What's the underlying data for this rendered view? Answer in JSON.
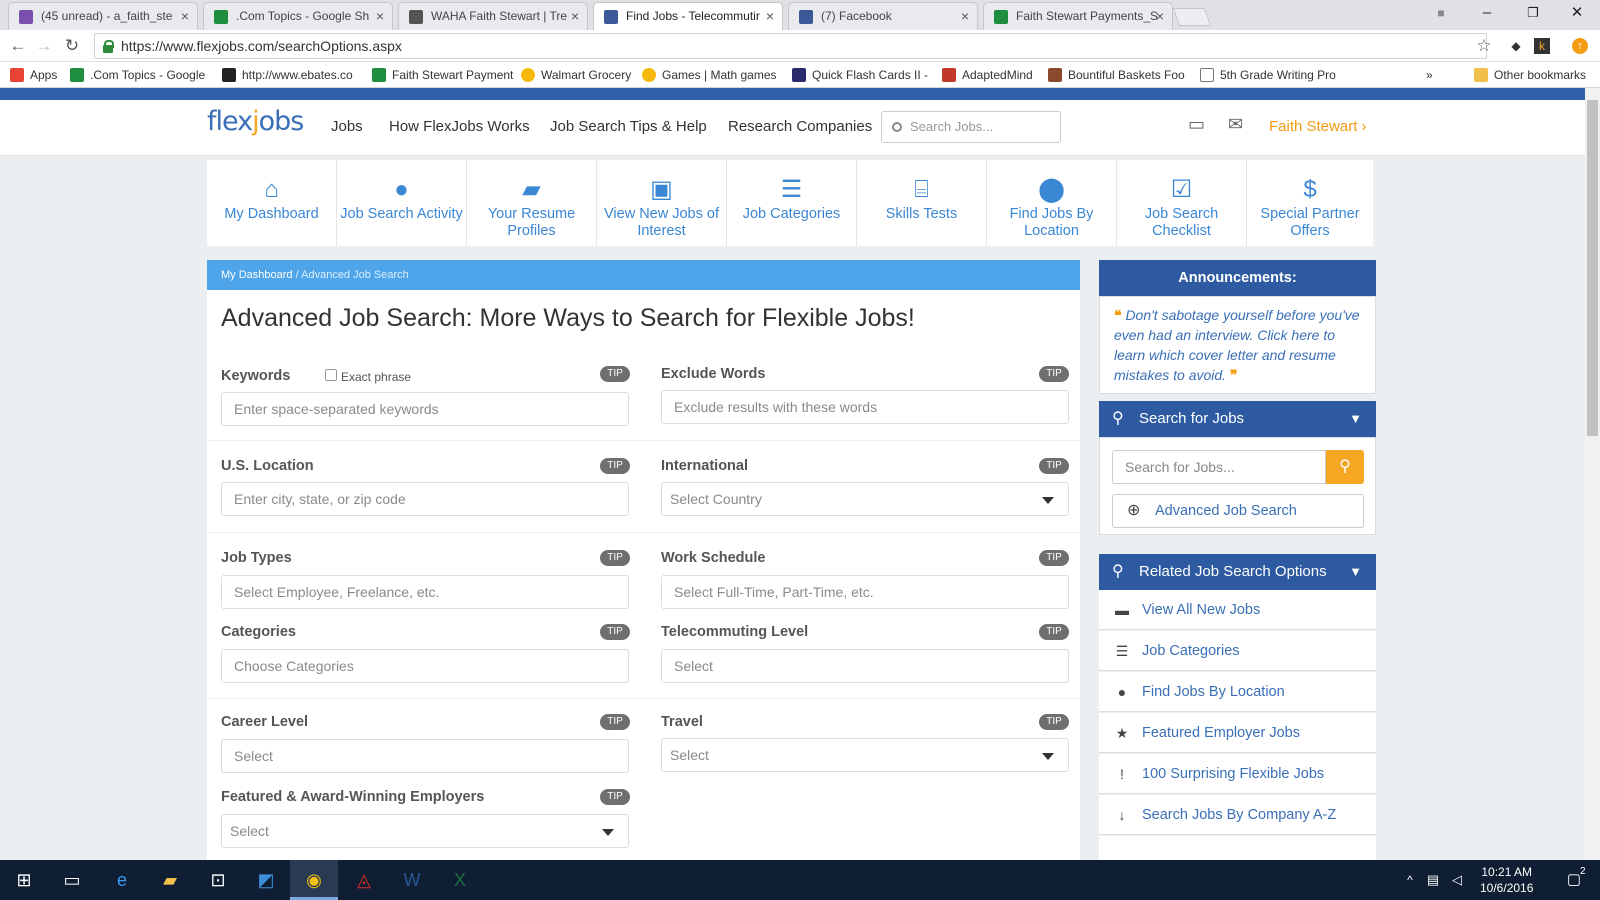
{
  "browser": {
    "tabs": [
      {
        "label": "(45 unread) - a_faith_ste",
        "icon": "mail-icon",
        "color": "#7b4fb0"
      },
      {
        "label": ".Com Topics - Google Sh",
        "icon": "sheets-icon",
        "color": "#1e8e3e"
      },
      {
        "label": "WAHA Faith Stewart | Tre",
        "icon": "trello-icon",
        "color": "#555555"
      },
      {
        "label": "Find Jobs - Telecommutir",
        "icon": "facebook-icon",
        "color": "#3b5998"
      },
      {
        "label": "(7) Facebook",
        "icon": "facebook-icon",
        "color": "#3b5998"
      },
      {
        "label": "Faith Stewart Payments_S",
        "icon": "sheets-icon",
        "color": "#1e8e3e"
      }
    ],
    "url": "https://www.flexjobs.com/searchOptions.aspx",
    "bookmarks": [
      {
        "label": "Apps",
        "color": "#e94335"
      },
      {
        "label": ".Com Topics - Google",
        "color": "#1e8e3e"
      },
      {
        "label": "http://www.ebates.co",
        "color": "#222222"
      },
      {
        "label": "Faith Stewart Payment",
        "color": "#1e8e3e"
      },
      {
        "label": "Walmart Grocery",
        "color": "#f6b80b"
      },
      {
        "label": "Games | Math games",
        "color": "#f6b80b"
      },
      {
        "label": "Quick Flash Cards II -",
        "color": "#2b2b6b"
      },
      {
        "label": "AdaptedMind",
        "color": "#c0392b"
      },
      {
        "label": "Bountiful Baskets Foo",
        "color": "#8b4a2b"
      },
      {
        "label": "5th Grade Writing Pro",
        "color": "#777777"
      }
    ],
    "more_bookmarks": "»",
    "other_bookmarks": "Other bookmarks"
  },
  "site": {
    "logo": {
      "pre": "flex",
      "o": "j",
      "post": "obs"
    },
    "nav": [
      "Jobs",
      "How FlexJobs Works",
      "Job Search Tips & Help",
      "Research Companies"
    ],
    "search_placeholder": "Search Jobs...",
    "user": "Faith Stewart",
    "user_chevron": "›"
  },
  "tiles": [
    {
      "label": "My Dashboard",
      "icon": "home-icon",
      "glyph": "⌂"
    },
    {
      "label": "Job Search Activity",
      "icon": "user-icon",
      "glyph": "●"
    },
    {
      "label": "Your Resume Profiles",
      "icon": "folder-open-icon",
      "glyph": "▰"
    },
    {
      "label": "View New Jobs of Interest",
      "icon": "briefcase-icon",
      "glyph": "▣"
    },
    {
      "label": "Job Categories",
      "icon": "list-icon",
      "glyph": "☰"
    },
    {
      "label": "Skills Tests",
      "icon": "bank-icon",
      "glyph": "⌸"
    },
    {
      "label": "Find Jobs By Location",
      "icon": "map-marker-icon",
      "glyph": "⬤"
    },
    {
      "label": "Job Search Checklist",
      "icon": "checkbox-icon",
      "glyph": "☑"
    },
    {
      "label": "Special Partner Offers",
      "icon": "dollar-icon",
      "glyph": "$"
    }
  ],
  "breadcrumb": {
    "home": "My Dashboard",
    "sep": "/",
    "current": "Advanced Job Search"
  },
  "page_title": "Advanced Job Search: More Ways to Search for Flexible Jobs!",
  "form": {
    "tip": "TIP",
    "keywords": {
      "label": "Keywords",
      "placeholder": "Enter space-separated keywords",
      "exact_phrase": "Exact phrase"
    },
    "exclude": {
      "label": "Exclude Words",
      "placeholder": "Exclude results with these words"
    },
    "us_location": {
      "label": "U.S. Location",
      "placeholder": "Enter city, state, or zip code"
    },
    "international": {
      "label": "International",
      "value": "Select Country"
    },
    "job_types": {
      "label": "Job Types",
      "placeholder": "Select Employee, Freelance, etc."
    },
    "work_schedule": {
      "label": "Work Schedule",
      "placeholder": "Select Full-Time, Part-Time, etc."
    },
    "categories": {
      "label": "Categories",
      "placeholder": "Choose Categories"
    },
    "telecommuting": {
      "label": "Telecommuting Level",
      "placeholder": "Select"
    },
    "career_level": {
      "label": "Career Level",
      "placeholder": "Select"
    },
    "travel": {
      "label": "Travel",
      "value": "Select"
    },
    "featured": {
      "label": "Featured & Award-Winning Employers",
      "value": "Select"
    }
  },
  "sidebar": {
    "announcements_title": "Announcements:",
    "announcement": "Don't sabotage yourself before you've even had an interview. Click here to learn which cover letter and resume mistakes to avoid.",
    "search_title": "Search for Jobs",
    "search_placeholder": "Search for Jobs...",
    "advanced_link": "Advanced Job Search",
    "related_title": "Related Job Search Options",
    "related": [
      {
        "label": "View All New Jobs",
        "icon": "briefcase-icon",
        "glyph": "▬"
      },
      {
        "label": "Job Categories",
        "icon": "list-icon",
        "glyph": "☰"
      },
      {
        "label": "Find Jobs By Location",
        "icon": "map-marker-icon",
        "glyph": "●"
      },
      {
        "label": "Featured Employer Jobs",
        "icon": "star-icon",
        "glyph": "★"
      },
      {
        "label": "100 Surprising Flexible Jobs",
        "icon": "exclamation-icon",
        "glyph": "!"
      },
      {
        "label": "Search Jobs By Company A-Z",
        "icon": "sort-alpha-icon",
        "glyph": "↓"
      }
    ]
  },
  "taskbar": {
    "time": "10:21 AM",
    "date": "10/6/2016",
    "notifications": "2"
  },
  "colors": {
    "brand_blue": "#2d5aa0",
    "accent_orange": "#f39c12",
    "link_blue": "#3a87d4",
    "breadcrumb": "#4ea5e9"
  }
}
